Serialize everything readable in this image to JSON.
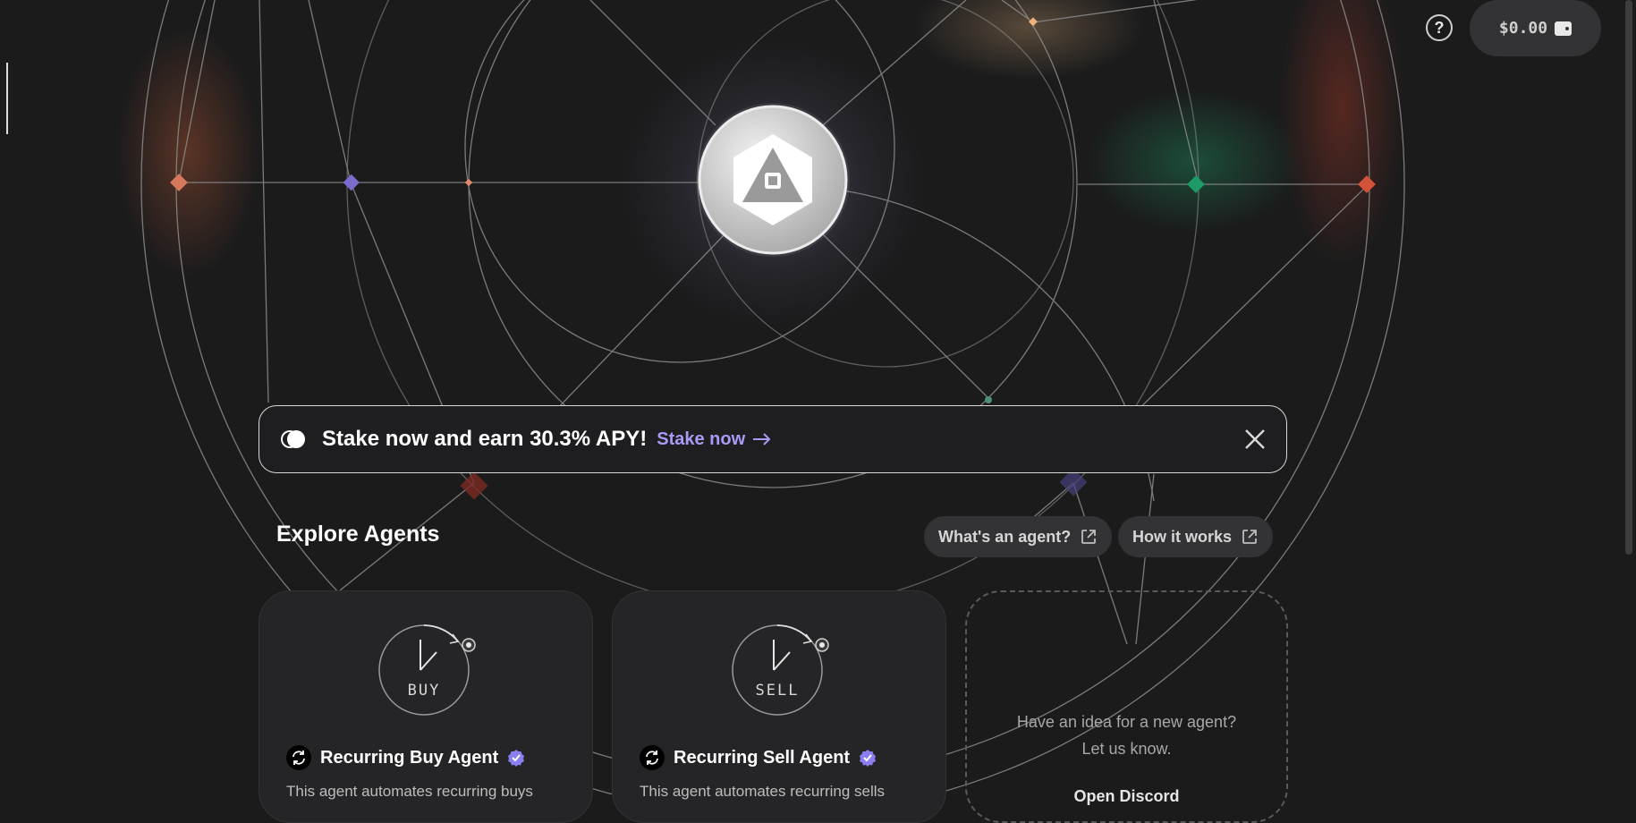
{
  "header": {
    "help_label": "?",
    "balance": "$0.00"
  },
  "banner": {
    "text": "Stake now and earn 30.3% APY!",
    "link_label": "Stake now"
  },
  "explore": {
    "title": "Explore Agents",
    "whats_agent_label": "What's an agent?",
    "how_it_works_label": "How it works"
  },
  "cards": [
    {
      "icon_text": "BUY",
      "title": "Recurring Buy Agent",
      "description": "This agent automates recurring buys"
    },
    {
      "icon_text": "SELL",
      "title": "Recurring Sell Agent",
      "description": "This agent automates recurring sells"
    }
  ],
  "idea_card": {
    "line1": "Have an idea for a new agent?",
    "line2": "Let us know.",
    "link_label": "Open Discord"
  },
  "colors": {
    "accent": "#a99af5",
    "background": "#1b1b1c",
    "card": "#252527",
    "pill": "#333335"
  }
}
